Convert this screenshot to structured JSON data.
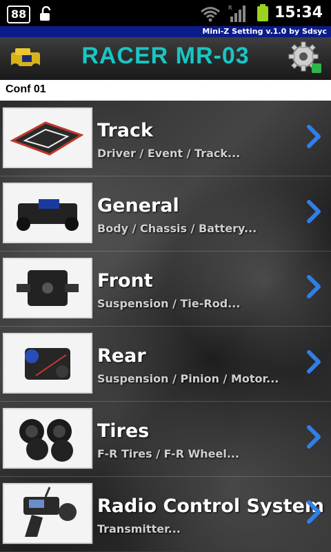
{
  "status": {
    "notification_count": "88",
    "time": "15:34",
    "signal_roaming": "R"
  },
  "app": {
    "bar_title": "Mini-Z Setting v.1.0 by Sdsyc",
    "header_title": "RACER MR-03",
    "config_name": "Conf 01"
  },
  "menu": [
    {
      "label": "Track",
      "subtitle": "Driver / Event / Track..."
    },
    {
      "label": "General",
      "subtitle": "Body / Chassis / Battery..."
    },
    {
      "label": "Front",
      "subtitle": "Suspension / Tie-Rod..."
    },
    {
      "label": "Rear",
      "subtitle": "Suspension / Pinion / Motor..."
    },
    {
      "label": "Tires",
      "subtitle": "F-R Tires / F-R Wheel..."
    },
    {
      "label": "Radio Control System",
      "subtitle": "Transmitter..."
    }
  ],
  "colors": {
    "title_accent": "#18c6c4",
    "app_bar": "#0b1b8a",
    "battery": "#9bd31f",
    "chevron": "#2f7fe8"
  },
  "icons": [
    "lock-open-icon",
    "wifi-icon",
    "signal-icon",
    "battery-icon",
    "car-logo-icon",
    "gear-settings-icon",
    "chevron-right-icon"
  ]
}
